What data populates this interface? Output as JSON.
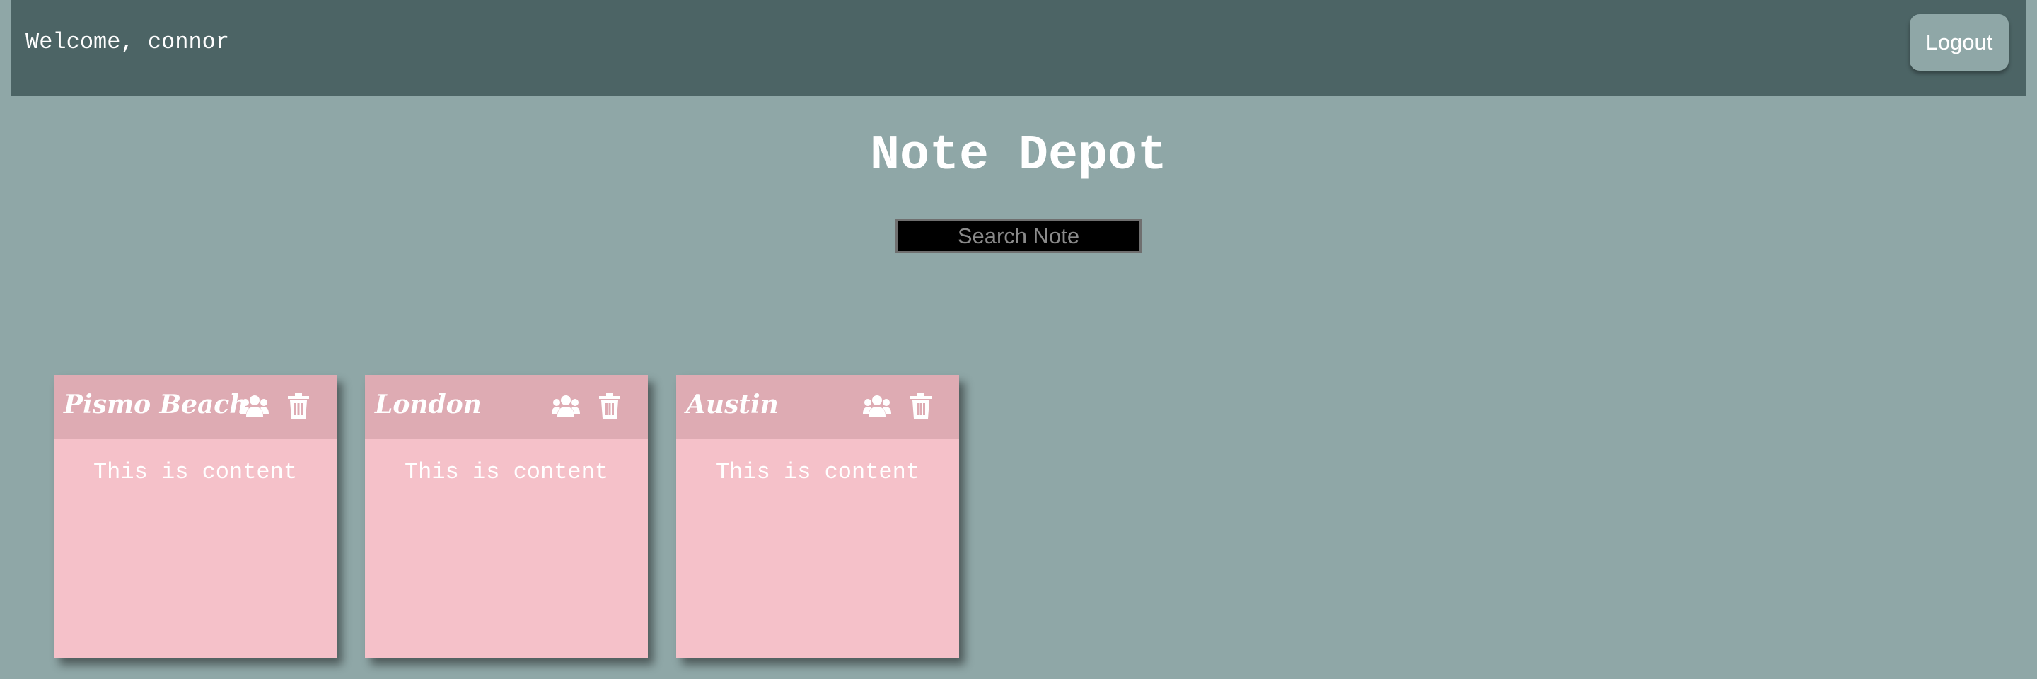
{
  "header": {
    "welcome": "Welcome, connor",
    "logout_label": "Logout"
  },
  "app": {
    "title": "Note Depot"
  },
  "search": {
    "placeholder": "Search Note",
    "value": ""
  },
  "notes": [
    {
      "title": "Pismo Beach",
      "content": "This is content",
      "share_icon": "users-icon",
      "delete_icon": "trash-icon"
    },
    {
      "title": "London",
      "content": "This is content",
      "share_icon": "users-icon",
      "delete_icon": "trash-icon"
    },
    {
      "title": "Austin",
      "content": "This is content",
      "share_icon": "users-icon",
      "delete_icon": "trash-icon"
    }
  ],
  "colors": {
    "page_background": "#8fa7a7",
    "topbar": "#4c6465",
    "note_body": "#f5c1c9",
    "note_header": "#deabb3",
    "search_background": "#000000",
    "text": "#ffffff"
  }
}
